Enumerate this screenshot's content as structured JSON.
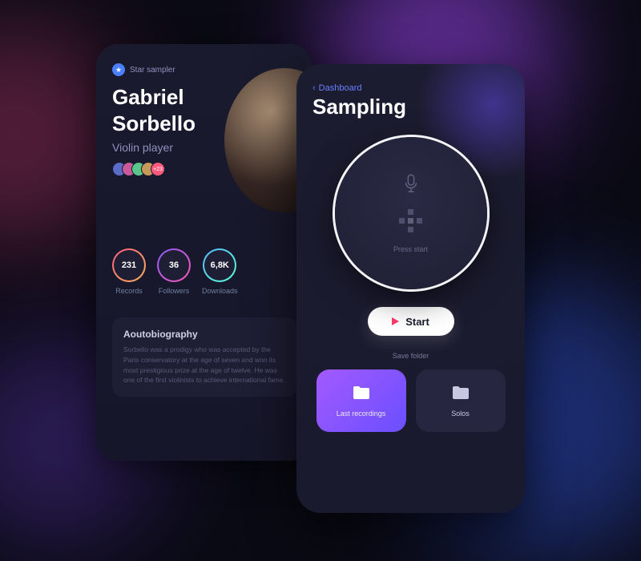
{
  "profile": {
    "badge_label": "Star sampler",
    "artist_first_name": "Gabriel",
    "artist_last_name": "Sorbello",
    "role": "Violin player",
    "avatar_more": "+23",
    "stats": {
      "records_value": "231",
      "records_label": "Records",
      "followers_value": "36",
      "followers_label": "Followers",
      "downloads_value": "6,8K",
      "downloads_label": "Downloads"
    },
    "bio_title": "Aoutobiography",
    "bio_text": "Sorbello was a prodigy who was accepted by the Paris conservatory at the age of seven and won its most prestigious prize at the age of twelve. He was one of the first violinists to achieve international fame."
  },
  "sampling": {
    "back_label": "Dashboard",
    "page_title": "Sampling",
    "press_text": "Press start",
    "start_label": "Start",
    "save_folder_label": "Save folder",
    "folders": {
      "last_recordings": "Last recordings",
      "solos": "Solos"
    }
  },
  "colors": {
    "accent_purple": "#8a5aff",
    "accent_pink": "#ff5a7e",
    "accent_blue": "#6a7fff"
  }
}
